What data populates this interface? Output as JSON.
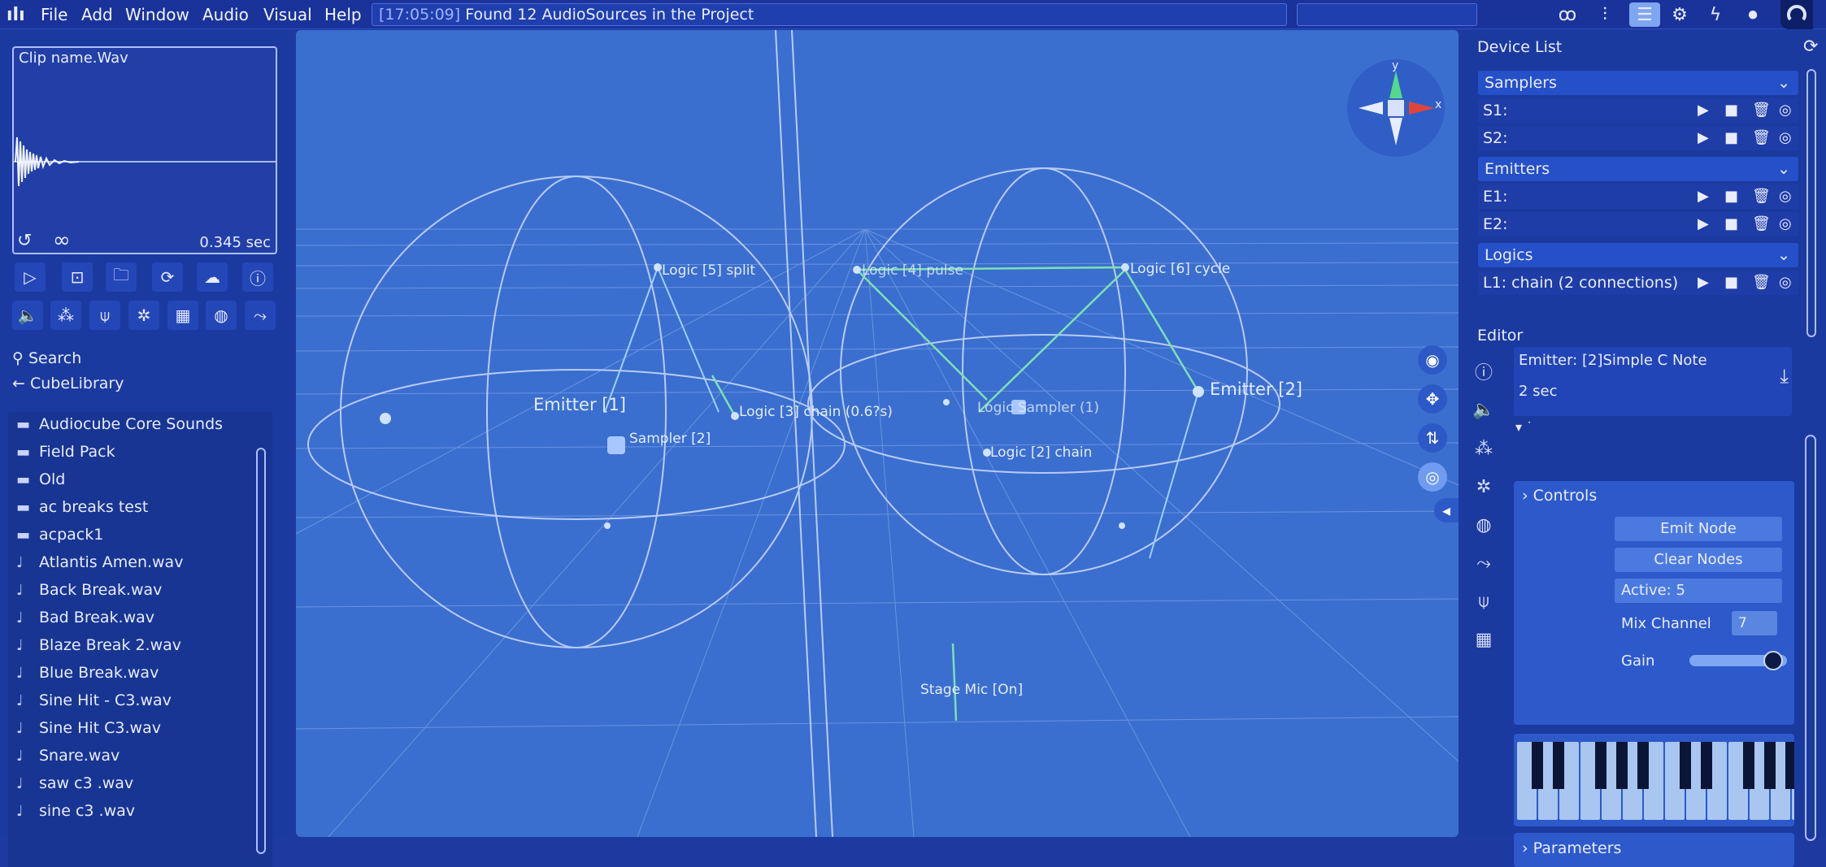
{
  "menu": {
    "items": [
      "File",
      "Add",
      "Window",
      "Audio",
      "Visual",
      "Help"
    ],
    "log_timestamp": "[17:05:09]",
    "log_message": "Found 12 AudioSources in the Project"
  },
  "toolbar_icons": [
    "voicemail-icon",
    "waveform-icon",
    "list-icon",
    "gear-icon",
    "bolt-icon",
    "record-icon",
    "progress-icon"
  ],
  "clip": {
    "name": "Clip name.Wav",
    "duration": "0.345 sec",
    "loop_symbol": "∞"
  },
  "left_panel": {
    "search_label": "Search",
    "library_label": "CubeLibrary",
    "folders": [
      "Audiocube Core Sounds",
      "Field Pack",
      "Old",
      "ac breaks test",
      "acpack1"
    ],
    "files": [
      "Atlantis Amen.wav",
      "Back Break.wav",
      "Bad Break.wav",
      "Blaze Break 2.wav",
      "Blue Break.wav",
      "Sine Hit - C3.wav",
      "Sine Hit C3.wav",
      "Snare.wav",
      "saw c3 .wav",
      "sine c3 .wav"
    ]
  },
  "viewport": {
    "labels": {
      "logic5": "Logic [5] split",
      "logic4": "Logic [4] pulse",
      "logic6": "Logic [6] cycle",
      "emitter1": "Emitter [1]",
      "emitter2": "Emitter [2]",
      "sampler2": "Sampler [2]",
      "logic3": "Logic [3] chain (0.6?s)",
      "logic2": "Logic [2] chain",
      "overlap": "Logic Sampler (1)",
      "stagemic": "Stage Mic [On]"
    },
    "gizmo": {
      "y": "y",
      "x": "x"
    }
  },
  "device_list": {
    "title": "Device List",
    "categories": [
      {
        "name": "Samplers",
        "devices": [
          "S1:",
          "S2:"
        ]
      },
      {
        "name": "Emitters",
        "devices": [
          "E1:",
          "E2:"
        ]
      },
      {
        "name": "Logics",
        "devices": [
          "L1: chain (2 connections)"
        ]
      }
    ]
  },
  "editor": {
    "title": "Editor",
    "emitter_name": "Emitter: [2]Simple C Note",
    "emitter_interval": "2 sec",
    "dropdown_marker": "▾ ˙",
    "controls_label": "Controls",
    "emit_button": "Emit Node",
    "clear_button": "Clear Nodes",
    "active_label": "Active: 5",
    "mix_channel_label": "Mix Channel",
    "mix_channel_value": "7",
    "gain_label": "Gain",
    "gain_level": 0.95,
    "parameters_label": "Parameters"
  }
}
